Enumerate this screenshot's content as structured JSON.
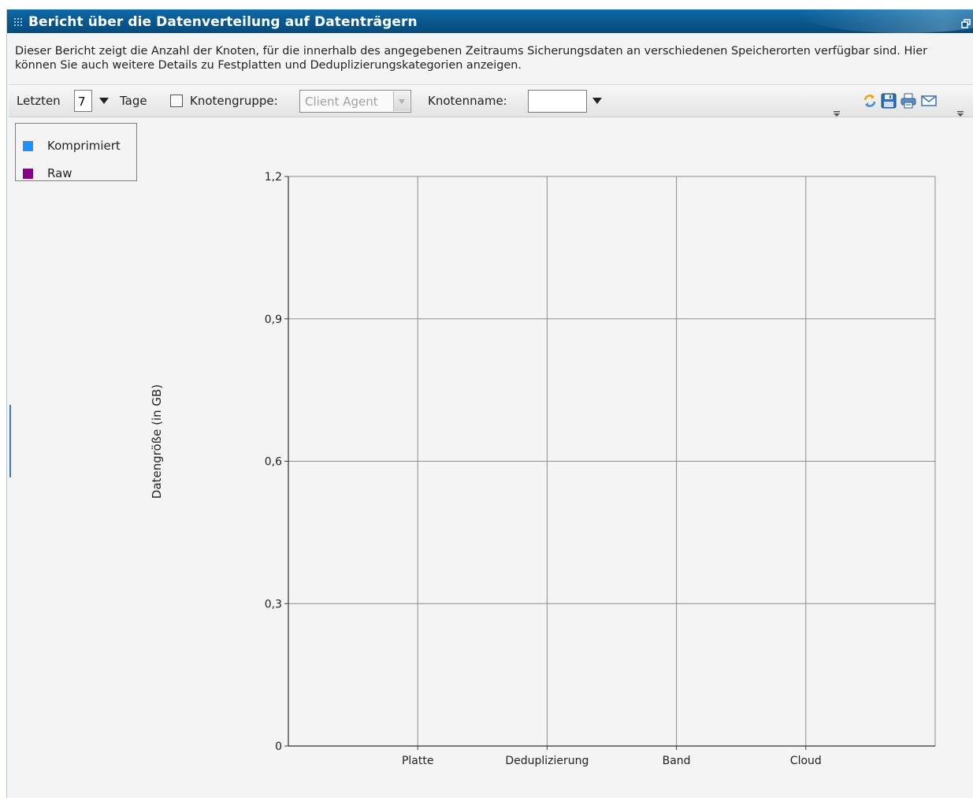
{
  "window": {
    "title": "Bericht über die Datenverteilung auf Datenträgern",
    "description": "Dieser Bericht zeigt die Anzahl der Knoten, für die innerhalb des angegebenen Zeitraums Sicherungsdaten an verschiedenen Speicherorten verfügbar sind. Hier können Sie auch weitere Details zu Festplatten und Deduplizierungskategorien anzeigen."
  },
  "toolbar": {
    "last_label": "Letzten",
    "days_value": "7",
    "days_label": "Tage",
    "node_group_label": "Knotengruppe:",
    "node_group_value": "Client Agent",
    "node_group_checked": false,
    "node_name_label": "Knotenname:",
    "node_name_value": "",
    "icons": {
      "refresh": "refresh-icon",
      "save": "save-icon",
      "print": "print-icon",
      "email": "email-icon"
    }
  },
  "legend": {
    "items": [
      {
        "label": "Komprimiert",
        "color": "#1e90ff"
      },
      {
        "label": "Raw",
        "color": "#8b008b"
      }
    ]
  },
  "chart_data": {
    "type": "bar",
    "categories": [
      "Platte",
      "Deduplizierung",
      "Band",
      "Cloud"
    ],
    "series": [
      {
        "name": "Komprimiert",
        "values": [
          0,
          0,
          0,
          0
        ],
        "color": "#1e90ff"
      },
      {
        "name": "Raw",
        "values": [
          0,
          0,
          0,
          0
        ],
        "color": "#8b008b"
      }
    ],
    "title": "",
    "xlabel": "",
    "ylabel": "Datengröße (in GB)",
    "ylim": [
      0,
      1.2
    ],
    "yticks": [
      0,
      0.3,
      0.6,
      0.9,
      1.2
    ],
    "ytick_labels": [
      "0",
      "0,3",
      "0,6",
      "0,9",
      "1,2"
    ],
    "grid": true,
    "legend_position": "top-left"
  }
}
